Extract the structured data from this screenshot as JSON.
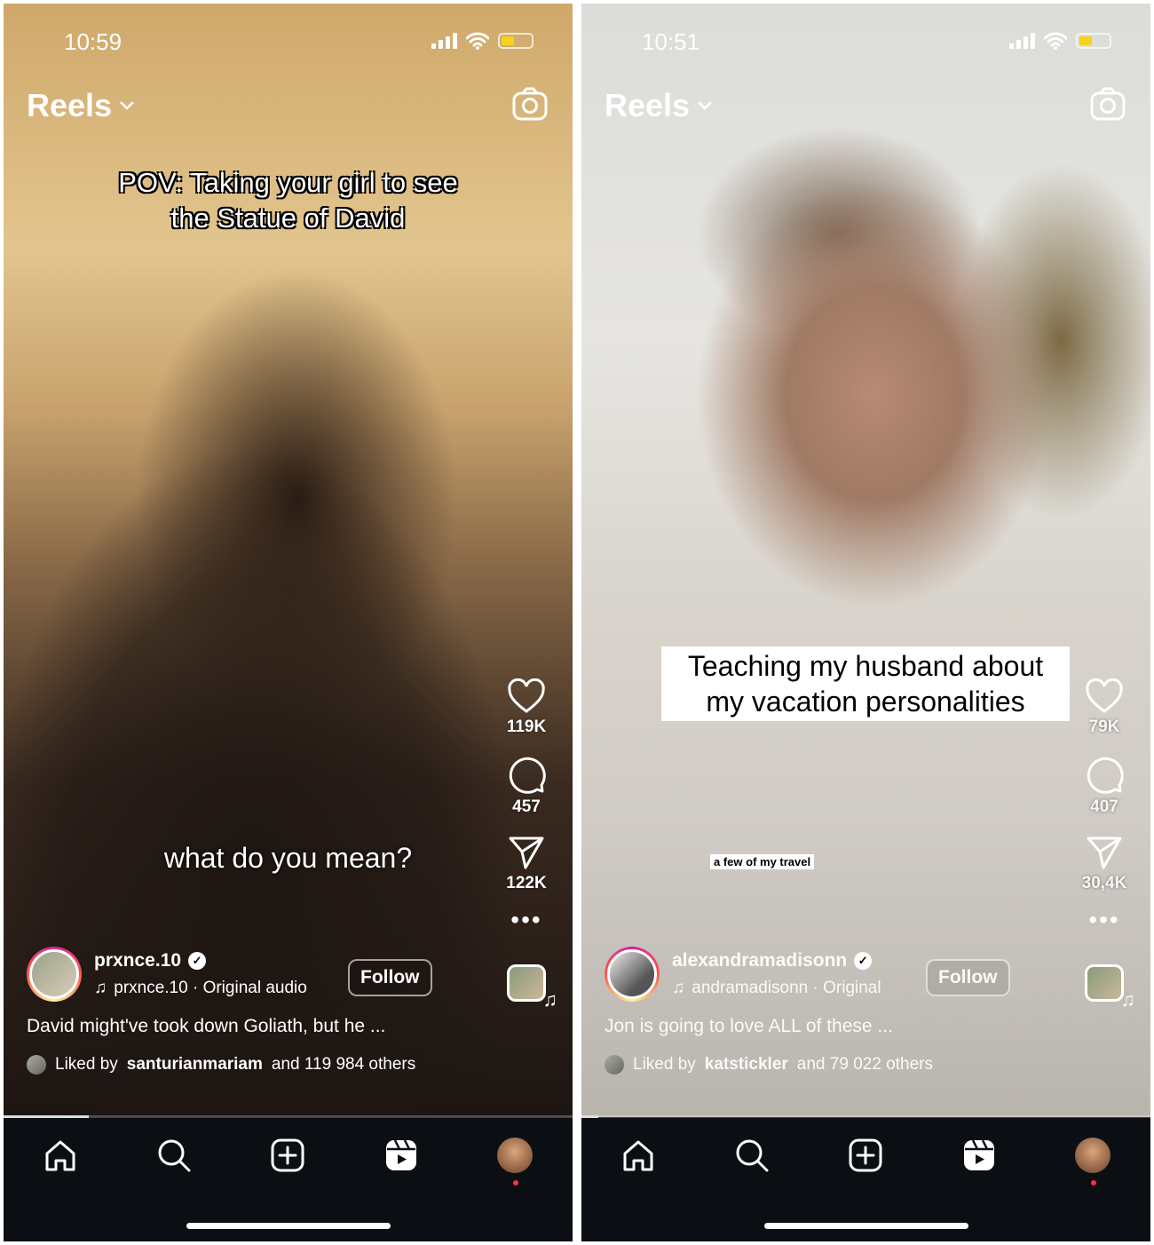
{
  "phones": [
    {
      "time": "10:59",
      "title": "Reels",
      "caption_top": [
        "POV: Taking your girl to see",
        "the Statue of David"
      ],
      "caption_mid": "what do you mean?",
      "likes": "119K",
      "comments": "457",
      "shares": "122K",
      "username": "prxnce.10",
      "audio": "prxnce.10 · Original audio",
      "follow_label": "Follow",
      "description": "David might've took down Goliath, but he ...",
      "liked_prefix": "Liked by",
      "liked_user": "santurianmariam",
      "liked_suffix": "and 119 984 others",
      "progress": 0.15
    },
    {
      "time": "10:51",
      "title": "Reels",
      "caption_box": [
        "Teaching my husband about",
        "my vacation personalities"
      ],
      "caption_small": "a few of my travel",
      "likes": "79K",
      "comments": "407",
      "shares": "30,4K",
      "username": "alexandramadisonn",
      "audio": "andramadisonn · Original",
      "follow_label": "Follow",
      "description": "Jon is going to love ALL of these ...",
      "liked_prefix": "Liked by",
      "liked_user": "katstickler",
      "liked_suffix": "and 79 022 others",
      "progress": 0.03
    }
  ],
  "icons": {
    "status": [
      "signal-icon",
      "wifi-icon",
      "battery-icon"
    ],
    "nav": [
      "home-icon",
      "search-icon",
      "create-icon",
      "reels-icon",
      "profile-avatar"
    ],
    "side": [
      "heart-icon",
      "comment-icon",
      "share-icon",
      "more-icon",
      "audio-icon"
    ]
  },
  "colors": {
    "battery": "#f5d31c",
    "nav_bg": "#0b0f13",
    "notification_dot": "#ff3040"
  }
}
